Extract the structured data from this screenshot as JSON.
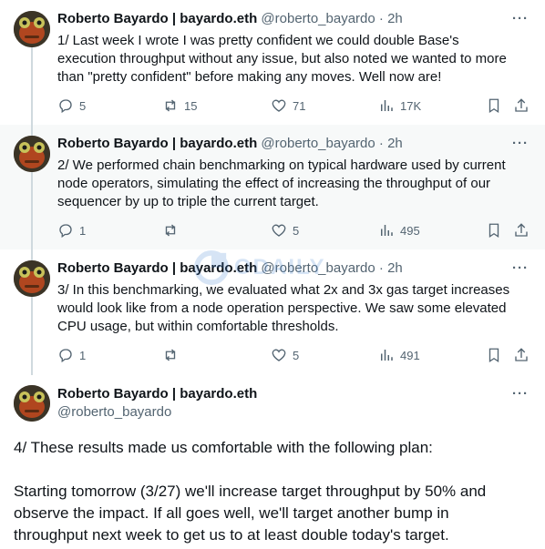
{
  "tweets": [
    {
      "author": "Roberto Bayardo | bayardo.eth",
      "handle": "@roberto_bayardo",
      "sep": "·",
      "time": "2h",
      "text": "1/ Last week I wrote I was pretty confident we could double Base's\nexecution throughput without any issue, but also noted we wanted to more\nthan \"pretty confident\" before making any moves. Well now are!",
      "replies": "5",
      "reposts": "15",
      "likes": "71",
      "views": "17K"
    },
    {
      "author": "Roberto Bayardo | bayardo.eth",
      "handle": "@roberto_bayardo",
      "sep": "·",
      "time": "2h",
      "text": "2/ We performed chain benchmarking on typical hardware used by current\nnode operators, simulating the effect of increasing the throughput of our\nsequencer by up to triple the current target.",
      "replies": "1",
      "reposts": "",
      "likes": "5",
      "views": "495"
    },
    {
      "author": "Roberto Bayardo | bayardo.eth",
      "handle": "@roberto_bayardo",
      "sep": "·",
      "time": "2h",
      "text": "3/ In this benchmarking, we evaluated what 2x and 3x gas target increases\nwould look like from a node operation perspective. We saw some elevated\nCPU usage, but within comfortable thresholds.",
      "replies": "1",
      "reposts": "",
      "likes": "5",
      "views": "491"
    }
  ],
  "main_tweet": {
    "author": "Roberto Bayardo | bayardo.eth",
    "handle": "@roberto_bayardo",
    "text": "4/ These results made us comfortable with the following plan:\n\nStarting tomorrow (3/27) we'll increase target throughput by 50% and\nobserve the impact. If all goes well, we'll target another bump in\nthroughput next week to get us to at least double today's target."
  },
  "more_label": "···",
  "watermark": "ODAILY",
  "colors": {
    "band": "#f7f9f9",
    "muted": "#536471",
    "line": "#cfd9de",
    "text": "#0f1419"
  }
}
